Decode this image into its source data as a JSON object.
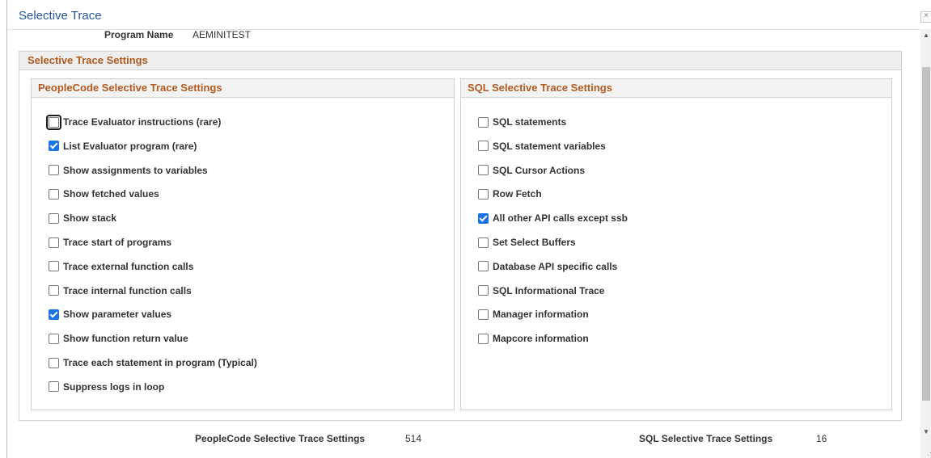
{
  "window": {
    "title": "Selective Trace",
    "close_glyph": "×"
  },
  "program": {
    "label": "Program Name",
    "value": "AEMINITEST"
  },
  "settings": {
    "title": "Selective Trace Settings",
    "peoplecode": {
      "title": "PeopleCode Selective Trace Settings",
      "options": [
        {
          "label": "Trace Evaluator instructions (rare)",
          "checked": false,
          "focused": true
        },
        {
          "label": "List Evaluator program (rare)",
          "checked": true
        },
        {
          "label": "Show assignments to variables",
          "checked": false
        },
        {
          "label": "Show fetched values",
          "checked": false
        },
        {
          "label": "Show stack",
          "checked": false
        },
        {
          "label": "Trace start of programs",
          "checked": false
        },
        {
          "label": "Trace external function calls",
          "checked": false
        },
        {
          "label": "Trace internal function calls",
          "checked": false
        },
        {
          "label": "Show parameter values",
          "checked": true
        },
        {
          "label": "Show function return value",
          "checked": false
        },
        {
          "label": "Trace each statement in program (Typical)",
          "checked": false
        },
        {
          "label": "Suppress logs in loop",
          "checked": false
        }
      ]
    },
    "sql": {
      "title": "SQL Selective Trace Settings",
      "options": [
        {
          "label": "SQL statements",
          "checked": false
        },
        {
          "label": "SQL statement variables",
          "checked": false
        },
        {
          "label": "SQL Cursor Actions",
          "checked": false
        },
        {
          "label": "Row Fetch",
          "checked": false
        },
        {
          "label": "All other API calls except ssb",
          "checked": true
        },
        {
          "label": "Set Select Buffers",
          "checked": false
        },
        {
          "label": "Database API specific calls",
          "checked": false
        },
        {
          "label": "SQL Informational Trace",
          "checked": false
        },
        {
          "label": "Manager information",
          "checked": false
        },
        {
          "label": "Mapcore information",
          "checked": false
        }
      ]
    }
  },
  "summary": {
    "peoplecode_label": "PeopleCode Selective Trace Settings",
    "peoplecode_value": "514",
    "sql_label": "SQL Selective Trace Settings",
    "sql_value": "16"
  },
  "colors": {
    "title": "#21559d",
    "section_title": "#b35a1f",
    "checkbox_checked": "#1a73e8"
  }
}
